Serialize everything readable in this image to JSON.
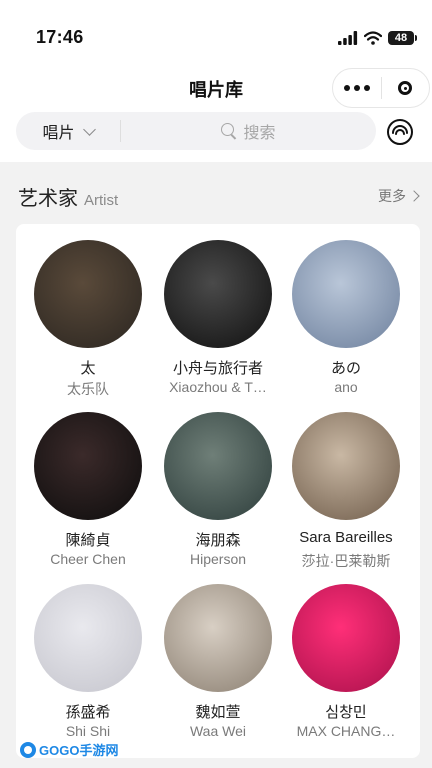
{
  "status_bar": {
    "time": "17:46",
    "battery": "48"
  },
  "nav": {
    "title": "唱片库"
  },
  "search": {
    "category": "唱片",
    "placeholder": "搜索"
  },
  "section": {
    "title": "艺术家",
    "subtitle": "Artist",
    "more": "更多"
  },
  "artists": [
    {
      "name": "太",
      "sub": "太乐队",
      "colors": [
        "#5a4a3a",
        "#2a2520"
      ]
    },
    {
      "name": "小舟与旅行者",
      "sub": "Xiaozhou & T…",
      "colors": [
        "#4a4a4a",
        "#0f0f0f"
      ]
    },
    {
      "name": "あの",
      "sub": "ano",
      "colors": [
        "#b9c6d8",
        "#6c7f9c"
      ]
    },
    {
      "name": "陳綺貞",
      "sub": "Cheer Chen",
      "colors": [
        "#3b2a2a",
        "#0c0c0c"
      ]
    },
    {
      "name": "海朋森",
      "sub": "Hiperson",
      "colors": [
        "#6f7f78",
        "#2c3c3a"
      ]
    },
    {
      "name": "Sara Bareilles",
      "sub": "莎拉·巴莱勒斯",
      "colors": [
        "#c9b8a4",
        "#6d5a48"
      ]
    },
    {
      "name": "孫盛希",
      "sub": "Shi Shi",
      "colors": [
        "#e9e9ee",
        "#c4c4cc"
      ]
    },
    {
      "name": "魏如萱",
      "sub": "Waa Wei",
      "colors": [
        "#d8cfc4",
        "#8a7e70"
      ]
    },
    {
      "name": "심창민",
      "sub": "MAX CHANG…",
      "colors": [
        "#ff2f78",
        "#a8104a"
      ]
    }
  ],
  "watermark": {
    "text": "GOGO手游网"
  }
}
